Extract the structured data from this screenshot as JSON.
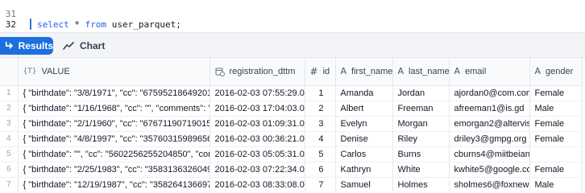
{
  "editor": {
    "line_numbers": [
      "31",
      "32"
    ],
    "code_tokens": {
      "select": "select",
      "star": " * ",
      "from": "from",
      "rest": " user_parquet;"
    }
  },
  "toolbar": {
    "results_label": "Results",
    "chart_label": "Chart"
  },
  "table": {
    "columns": [
      {
        "label": "VALUE",
        "type_icon": "{T}"
      },
      {
        "label": "registration_dttm",
        "type_icon": "calendar-clock"
      },
      {
        "label": "id",
        "type_icon": "#"
      },
      {
        "label": "first_name",
        "type_icon": "A"
      },
      {
        "label": "last_name",
        "type_icon": "A"
      },
      {
        "label": "email",
        "type_icon": "A"
      },
      {
        "label": "gender",
        "type_icon": "A"
      }
    ],
    "rows": [
      {
        "n": "1",
        "value": "{  \"birthdate\": \"3/8/1971\",  \"cc\": \"6759521864920116\",  \"c",
        "dttm": "2016-02-03 07:55:29.000",
        "id": "1",
        "first": "Amanda",
        "last": "Jordan",
        "email": "ajordan0@com.com",
        "gender": "Female"
      },
      {
        "n": "2",
        "value": "{  \"birthdate\": \"1/16/1968\",  \"cc\": \"\",  \"comments\": \"\",  \"cour",
        "dttm": "2016-02-03 17:04:03.000",
        "id": "2",
        "first": "Albert",
        "last": "Freeman",
        "email": "afreeman1@is.gd",
        "gender": "Male"
      },
      {
        "n": "3",
        "value": "{  \"birthdate\": \"2/1/1960\",  \"cc\": \"6767119071901597\",  \"c",
        "dttm": "2016-02-03 01:09:31.000",
        "id": "3",
        "first": "Evelyn",
        "last": "Morgan",
        "email": "emorgan2@altervista.or",
        "gender": "Female"
      },
      {
        "n": "4",
        "value": "{  \"birthdate\": \"4/8/1997\",  \"cc\": \"3576031598965625\",  \"c",
        "dttm": "2016-02-03 00:36:21.000",
        "id": "4",
        "first": "Denise",
        "last": "Riley",
        "email": "driley3@gmpg.org",
        "gender": "Female"
      },
      {
        "n": "5",
        "value": "{  \"birthdate\": \"\",  \"cc\": \"5602256255204850\",  \"comments",
        "dttm": "2016-02-03 05:05:31.000",
        "id": "5",
        "first": "Carlos",
        "last": "Burns",
        "email": "cburns4@miitbeian.gov.",
        "gender": ""
      },
      {
        "n": "6",
        "value": "{  \"birthdate\": \"2/25/1983\",  \"cc\": \"3583136326049310\",  \"",
        "dttm": "2016-02-03 07:22:34.000",
        "id": "6",
        "first": "Kathryn",
        "last": "White",
        "email": "kwhite5@google.com",
        "gender": "Female"
      },
      {
        "n": "7",
        "value": "{  \"birthdate\": \"12/19/1987\",  \"cc\": \"3582641366974690\"",
        "dttm": "2016-02-03 08:33:08.000",
        "id": "7",
        "first": "Samuel",
        "last": "Holmes",
        "email": "sholmes6@foxnews.com",
        "gender": "Male"
      }
    ]
  },
  "colors": {
    "accent": "#1d6fe0",
    "cursor": "#2f6fed",
    "keyword": "#2563eb"
  }
}
